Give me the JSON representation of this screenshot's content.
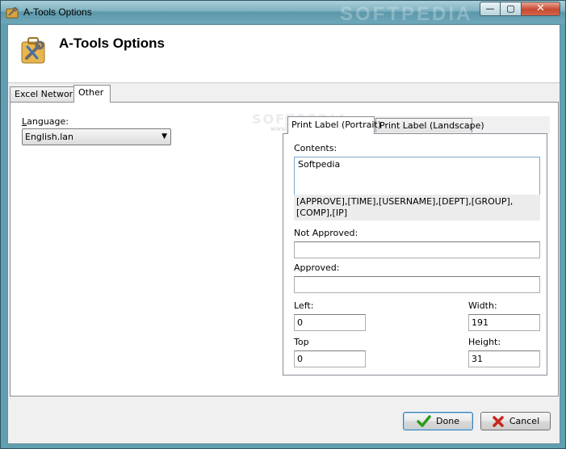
{
  "window": {
    "title": "A-Tools Options",
    "watermark": "SOFTPEDIA",
    "controls": {
      "minimize": "—",
      "maximize": "▢",
      "close": "✕"
    }
  },
  "header": {
    "title": "A-Tools Options"
  },
  "tabs": [
    {
      "label": "Excel Network",
      "active": false
    },
    {
      "label": "Other",
      "active": true
    }
  ],
  "other": {
    "language_label": "Language:",
    "language_value": "English.lan",
    "watermark": "SOFTPEDIA",
    "watermark_url": "www.softpedia.com"
  },
  "print_tabs": [
    {
      "label": "Print Label (Portrait)",
      "active": true
    },
    {
      "label": "Print Label (Landscape)",
      "active": false
    }
  ],
  "portrait": {
    "contents_label": "Contents:",
    "contents_value": "Softpedia",
    "variables_hint": "[APPROVE],[TIME],[USERNAME],[DEPT],[GROUP],[COMP],[IP]",
    "not_approved_label": "Not Approved:",
    "not_approved_value": "",
    "approved_label": "Approved:",
    "approved_value": "",
    "left_label": "Left:",
    "left_value": "0",
    "top_label": "Top",
    "top_value": "0",
    "width_label": "Width:",
    "width_value": "191",
    "height_label": "Height:",
    "height_value": "31"
  },
  "buttons": {
    "done": "Done",
    "cancel": "Cancel"
  },
  "colors": {
    "titlebar": "#7fb2c1",
    "done_icon": "#2e9a1e",
    "cancel_icon": "#c8261a"
  }
}
